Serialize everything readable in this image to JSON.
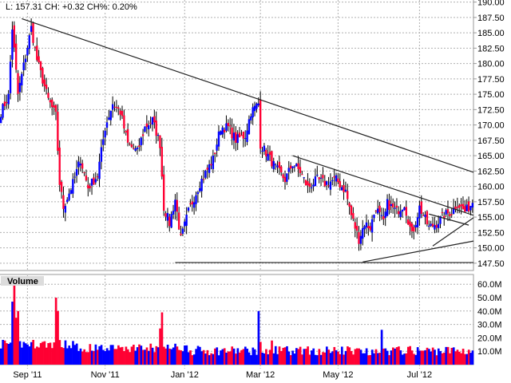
{
  "header": {
    "text": "L: 157.31 CH: +0.32 CH%: 0.20%"
  },
  "chart_data": {
    "type": "candlestick",
    "title": "L: 157.31 CH: +0.32 CH%: 0.20%",
    "last": 157.31,
    "change": 0.32,
    "change_pct": 0.2,
    "price_axis": {
      "ylim": [
        146.5,
        190.5
      ],
      "ticks": [
        "190.00",
        "187.50",
        "185.00",
        "182.50",
        "180.00",
        "177.50",
        "175.00",
        "172.50",
        "170.00",
        "167.50",
        "165.00",
        "162.50",
        "160.00",
        "157.50",
        "155.00",
        "152.50",
        "150.00",
        "147.50"
      ]
    },
    "volume_panel": {
      "label": "Volume",
      "ylim": [
        0,
        66
      ],
      "unit": "M",
      "ticks": [
        "60.0M",
        "50.0M",
        "40.0M",
        "30.0M",
        "20.0M",
        "10.0M"
      ]
    },
    "x_axis": {
      "days": 250,
      "ticks": [
        {
          "label": "Sep '11",
          "day": 14
        },
        {
          "label": "Nov '11",
          "day": 55
        },
        {
          "label": "Jan '12",
          "day": 97
        },
        {
          "label": "Mar '12",
          "day": 137
        },
        {
          "label": "May '12",
          "day": 178
        },
        {
          "label": "Jul '12",
          "day": 221
        }
      ]
    },
    "close_keypoints": [
      [
        0,
        172.1
      ],
      [
        4,
        174.7
      ],
      [
        6,
        185.8
      ],
      [
        9,
        175
      ],
      [
        13,
        181.2
      ],
      [
        16,
        185.8
      ],
      [
        19,
        180.6
      ],
      [
        25,
        174.1
      ],
      [
        29,
        171.5
      ],
      [
        31,
        160.5
      ],
      [
        33,
        156.6
      ],
      [
        38,
        160.5
      ],
      [
        42,
        164.4
      ],
      [
        46,
        159.8
      ],
      [
        51,
        161.8
      ],
      [
        55,
        169.6
      ],
      [
        59,
        173.5
      ],
      [
        63,
        172.1
      ],
      [
        67,
        166.9
      ],
      [
        72,
        165.6
      ],
      [
        76,
        169.6
      ],
      [
        80,
        170.8
      ],
      [
        84,
        166.9
      ],
      [
        86,
        156.6
      ],
      [
        89,
        154.0
      ],
      [
        92,
        157.9
      ],
      [
        95,
        151.4
      ],
      [
        99,
        155.9
      ],
      [
        105,
        160.5
      ],
      [
        112,
        164.4
      ],
      [
        116,
        169.6
      ],
      [
        120,
        169.6
      ],
      [
        124,
        167.6
      ],
      [
        129,
        168.3
      ],
      [
        132,
        172.1
      ],
      [
        136,
        173.5
      ],
      [
        137,
        166.9
      ],
      [
        141,
        165.0
      ],
      [
        145,
        163.0
      ],
      [
        150,
        161.1
      ],
      [
        154,
        163.7
      ],
      [
        158,
        162.4
      ],
      [
        162,
        159.8
      ],
      [
        167,
        161.1
      ],
      [
        171,
        160.5
      ],
      [
        177,
        161.1
      ],
      [
        182,
        159.2
      ],
      [
        185,
        155.3
      ],
      [
        189,
        151.4
      ],
      [
        192,
        154.0
      ],
      [
        195,
        153.3
      ],
      [
        198,
        156.6
      ],
      [
        202,
        154.0
      ],
      [
        204,
        157.2
      ],
      [
        209,
        155.9
      ],
      [
        213,
        157.2
      ],
      [
        217,
        152.0
      ],
      [
        221,
        156.6
      ],
      [
        226,
        153.3
      ],
      [
        230,
        154.0
      ],
      [
        234,
        155.3
      ],
      [
        238,
        155.9
      ],
      [
        241,
        157.2
      ],
      [
        245,
        155.9
      ],
      [
        249,
        157.31
      ]
    ],
    "volume_spikes_m": [
      [
        7,
        63.7
      ],
      [
        6,
        47
      ],
      [
        9,
        40
      ],
      [
        8,
        35
      ],
      [
        29,
        50
      ],
      [
        30,
        40
      ],
      [
        85,
        39
      ],
      [
        84,
        27
      ],
      [
        136,
        40
      ],
      [
        137,
        17
      ],
      [
        201,
        26
      ],
      [
        143,
        18
      ]
    ],
    "trendlines": [
      {
        "from": [
          11,
          187.3
        ],
        "to": [
          250,
          162.3
        ]
      },
      {
        "from": [
          154,
          165.0
        ],
        "to": [
          250,
          155.3
        ]
      },
      {
        "from": [
          92,
          147.6
        ],
        "to": [
          250,
          147.6
        ]
      },
      {
        "from": [
          191,
          147.7
        ],
        "to": [
          250,
          151.1
        ]
      },
      {
        "from": [
          228,
          150.3
        ],
        "to": [
          250,
          154.9
        ]
      },
      {
        "from": [
          226,
          155.5
        ],
        "to": [
          247,
          153.7
        ]
      }
    ],
    "colors": {
      "up": "#0000ff",
      "down": "#ff0033",
      "wick": "#000000",
      "grid": "#b0b0b0",
      "frame": "#999999"
    }
  }
}
